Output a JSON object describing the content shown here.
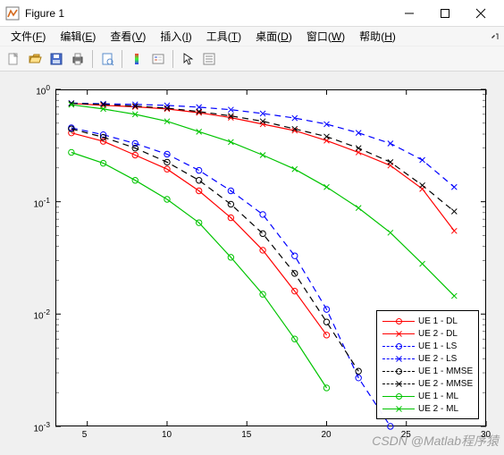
{
  "window": {
    "title": "Figure 1"
  },
  "menu": {
    "file": {
      "label": "文件",
      "accel": "F"
    },
    "edit": {
      "label": "编辑",
      "accel": "E"
    },
    "view": {
      "label": "查看",
      "accel": "V"
    },
    "insert": {
      "label": "插入",
      "accel": "I"
    },
    "tools": {
      "label": "工具",
      "accel": "T"
    },
    "desktop": {
      "label": "桌面",
      "accel": "D"
    },
    "window": {
      "label": "窗口",
      "accel": "W"
    },
    "help": {
      "label": "帮助",
      "accel": "H"
    }
  },
  "toolbar": {
    "new": "new-figure",
    "open": "open",
    "save": "save",
    "print": "print",
    "printpreview": "print-preview",
    "colorbar": "insert-colorbar",
    "legend": "insert-legend",
    "pointer": "edit-plot",
    "props": "open-property-inspector"
  },
  "watermark": "CSDN @Matlab程序猿",
  "chart_data": {
    "type": "line",
    "xlabel": "",
    "ylabel": "",
    "xlim": [
      3,
      30
    ],
    "ylim": [
      0.001,
      1
    ],
    "yscale": "log",
    "xticks": [
      5,
      10,
      15,
      20,
      25,
      30
    ],
    "yticks": [
      0.001,
      0.01,
      0.1,
      1
    ],
    "ytick_labels": [
      "10^{-3}",
      "10^{-2}",
      "10^{-1}",
      "10^{0}"
    ],
    "x": [
      4,
      6,
      8,
      10,
      12,
      14,
      16,
      18,
      20,
      22,
      24,
      26,
      28
    ],
    "series": [
      {
        "name": "UE 1 - DL",
        "color": "#ff0000",
        "dash": "solid",
        "marker": "o",
        "values": [
          0.41,
          0.345,
          0.26,
          0.195,
          0.125,
          0.072,
          0.037,
          0.016,
          0.0065,
          null,
          null,
          null,
          null
        ]
      },
      {
        "name": "UE 2 - DL",
        "color": "#ff0000",
        "dash": "solid",
        "marker": "x",
        "values": [
          0.75,
          0.72,
          0.7,
          0.67,
          0.62,
          0.56,
          0.49,
          0.43,
          0.35,
          0.275,
          0.21,
          0.13,
          0.055
        ]
      },
      {
        "name": "UE 1 - LS",
        "color": "#0000ff",
        "dash": "dashed",
        "marker": "o",
        "values": [
          0.455,
          0.395,
          0.33,
          0.265,
          0.19,
          0.125,
          0.077,
          0.033,
          0.011,
          0.0027,
          0.001,
          null,
          null
        ]
      },
      {
        "name": "UE 2 - LS",
        "color": "#0000ff",
        "dash": "dashed",
        "marker": "x",
        "values": [
          0.755,
          0.745,
          0.735,
          0.72,
          0.695,
          0.66,
          0.61,
          0.555,
          0.49,
          0.41,
          0.33,
          0.235,
          0.135
        ]
      },
      {
        "name": "UE 1 - MMSE",
        "color": "#000000",
        "dash": "dashed",
        "marker": "o",
        "values": [
          0.445,
          0.375,
          0.3,
          0.225,
          0.155,
          0.095,
          0.052,
          0.023,
          0.0085,
          0.0031,
          null,
          null,
          null
        ]
      },
      {
        "name": "UE 2 - MMSE",
        "color": "#000000",
        "dash": "dashed",
        "marker": "x",
        "values": [
          0.75,
          0.735,
          0.71,
          0.68,
          0.635,
          0.58,
          0.52,
          0.445,
          0.38,
          0.3,
          0.225,
          0.14,
          0.082
        ]
      },
      {
        "name": "UE 1 - ML",
        "color": "#00c400",
        "dash": "solid",
        "marker": "o",
        "values": [
          0.275,
          0.22,
          0.155,
          0.105,
          0.065,
          0.032,
          0.015,
          0.006,
          0.0022,
          null,
          null,
          null,
          null
        ]
      },
      {
        "name": "UE 2 - ML",
        "color": "#00c400",
        "dash": "solid",
        "marker": "x",
        "values": [
          0.73,
          0.67,
          0.6,
          0.52,
          0.42,
          0.34,
          0.26,
          0.195,
          0.135,
          0.088,
          0.053,
          0.028,
          0.0145
        ]
      }
    ]
  }
}
